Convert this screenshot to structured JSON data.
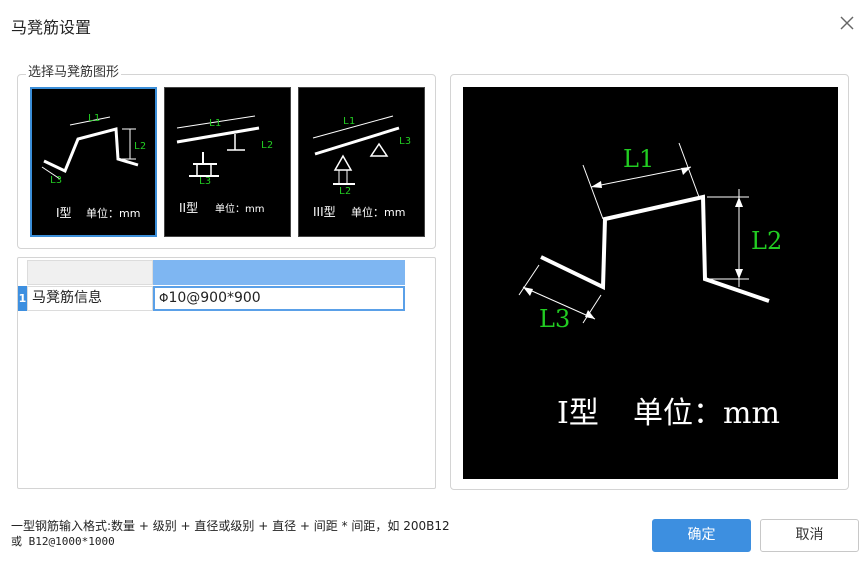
{
  "dialog": {
    "title": "马凳筋设置",
    "close_icon": "close-icon"
  },
  "shape_group": {
    "label": "选择马凳筋图形",
    "shapes": [
      {
        "type_label": "I型",
        "unit_label": "单位：mm",
        "dims": [
          "L1",
          "L2",
          "L3"
        ],
        "selected": true
      },
      {
        "type_label": "II型",
        "unit_label": "单位：mm",
        "dims": [
          "L1",
          "L2",
          "L3"
        ],
        "selected": false
      },
      {
        "type_label": "III型",
        "unit_label": "单位：mm",
        "dims": [
          "L1",
          "L2",
          "L3"
        ],
        "selected": false
      }
    ]
  },
  "grid": {
    "rows": [
      {
        "num": "1",
        "name": "马凳筋信息",
        "value": "10@900*900",
        "grade_symbol": "Φ"
      }
    ]
  },
  "preview": {
    "type_label": "I型",
    "unit_label": "单位：mm",
    "dims": [
      "L1",
      "L2",
      "L3"
    ]
  },
  "hint": {
    "line1": "一型钢筋输入格式:数量 + 级别 + 直径或级别 + 直径 + 间距 * 间距，如 200B12",
    "line2": "或 B12@1000*1000"
  },
  "buttons": {
    "ok_label": "确定",
    "cancel_label": "取消"
  },
  "colors": {
    "accent": "#3d8fe0",
    "dimension_text": "#22cc22",
    "drawing_line": "#ffffff",
    "preview_background": "#000000"
  }
}
